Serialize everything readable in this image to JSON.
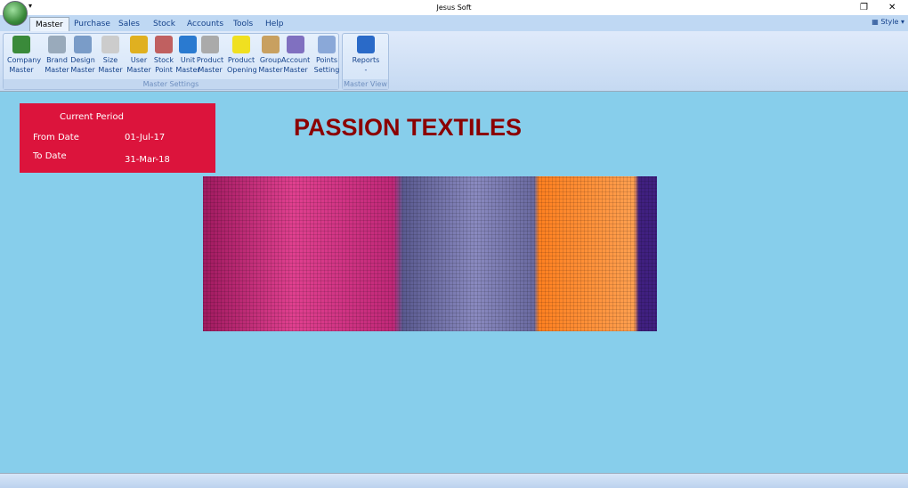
{
  "window": {
    "title": "Jesus Soft",
    "style_label": "Style"
  },
  "tabs": [
    "Master",
    "Purchase",
    "Sales",
    "Stock",
    "Accounts",
    "Tools",
    "Help"
  ],
  "ribbon": {
    "groups": [
      {
        "label": "Master Settings",
        "buttons": [
          [
            "Company",
            "Master"
          ],
          [
            "Brand",
            "Master"
          ],
          [
            "Design",
            "Master"
          ],
          [
            "Size",
            "Master"
          ],
          [
            "User",
            "Master"
          ],
          [
            "Stock",
            "Point"
          ],
          [
            "Unit",
            "Master"
          ],
          [
            "Product",
            "Master"
          ],
          [
            "Product",
            "Opening"
          ],
          [
            "Group",
            "Master"
          ],
          [
            "Account",
            "Master"
          ],
          [
            "Points",
            "Setting"
          ]
        ]
      },
      {
        "label": "Master View",
        "buttons": [
          [
            "Reports",
            "-"
          ]
        ]
      }
    ]
  },
  "period": {
    "title": "Current Period",
    "from_label": "From Date",
    "from_value": "01-Jul-17",
    "to_label": "To Date",
    "to_value": "31-Mar-18"
  },
  "company_name": "PASSION TEXTILES"
}
